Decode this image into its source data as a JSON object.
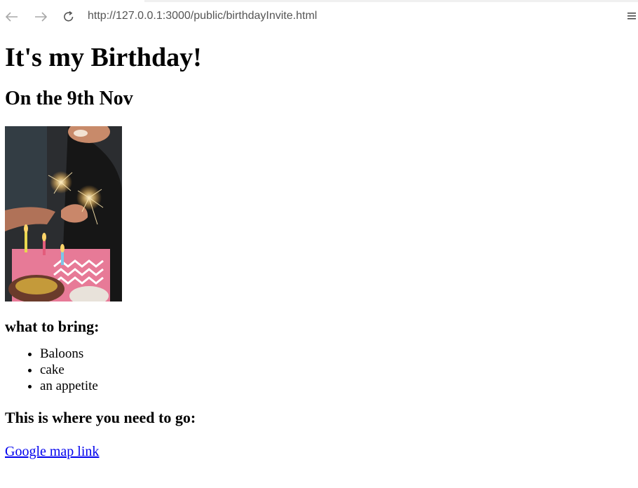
{
  "browser": {
    "url": "http://127.0.0.1:3000/public/birthdayInvite.html",
    "back_icon": "arrow-left-icon",
    "forward_icon": "arrow-right-icon",
    "reload_icon": "reload-icon",
    "menu_icon": "menu-icon"
  },
  "page": {
    "title": "It's my Birthday!",
    "date": "On the 9th Nov",
    "bring_heading": "what to bring:",
    "bring_items": [
      "Baloons",
      "cake",
      "an appetite"
    ],
    "where_heading": "This is where you need to go:",
    "map_link": "Google map link"
  }
}
